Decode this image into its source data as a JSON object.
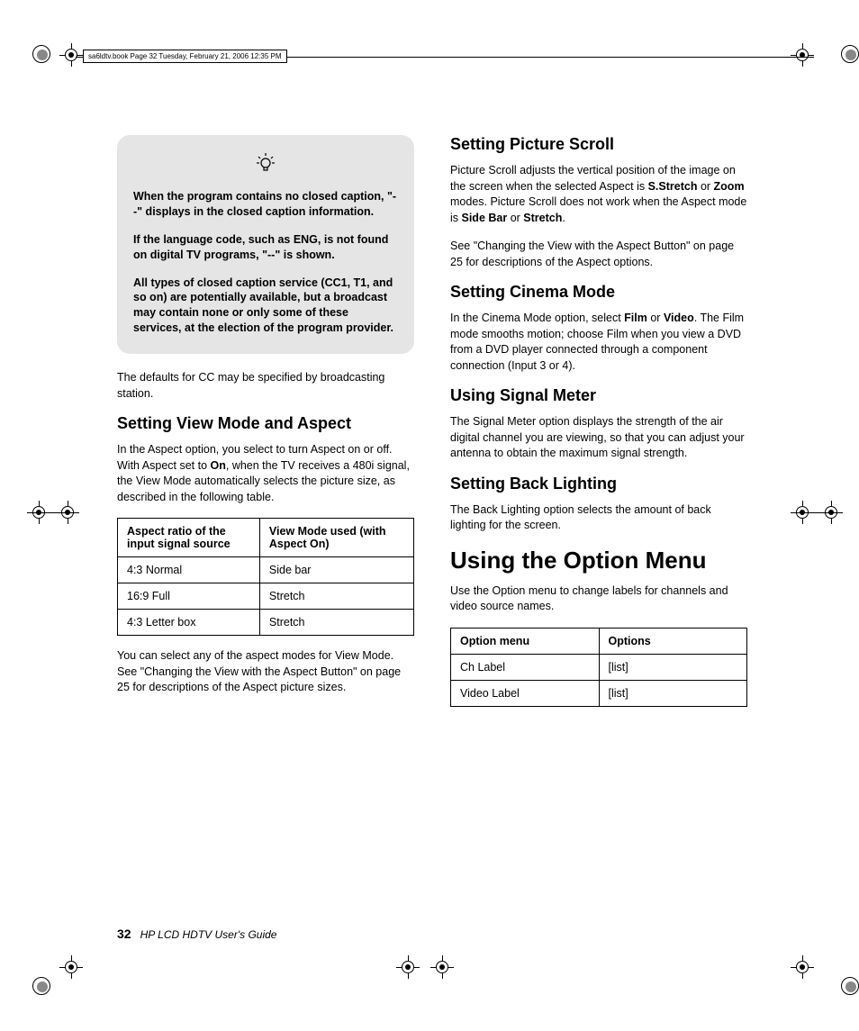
{
  "header": {
    "meta": "sa6ldtv.book  Page 32  Tuesday, February 21, 2006  12:35 PM"
  },
  "left": {
    "note1": "When the program contains no closed caption, \"--\" displays in the closed caption information.",
    "note2": "If the language code, such as ENG, is not found on digital TV programs, \"--\" is shown.",
    "note3": "All types of closed caption service (CC1, T1, and so on) are potentially available, but a broadcast may contain none or only some of these services, at the election of the program provider.",
    "p1": "The defaults for CC may be specified by broadcasting station.",
    "h_view": "Setting View Mode and Aspect",
    "p_view_a": "In the Aspect option, you select to turn Aspect on or off. With Aspect set to ",
    "p_view_b": "On",
    "p_view_c": ", when the TV receives a 480i signal, the View Mode automatically selects the picture size, as described in the following table.",
    "th1": "Aspect ratio of the input signal source",
    "th2": "View Mode used (with Aspect On)",
    "r1c1": "4:3 Normal",
    "r1c2": "Side bar",
    "r2c1": "16:9 Full",
    "r2c2": "Stretch",
    "r3c1": "4:3 Letter box",
    "r3c2": "Stretch",
    "p_after": "You can select any of the aspect modes for View Mode. See \"Changing the View with the Aspect Button\" on page 25 for descriptions of the Aspect picture sizes."
  },
  "right": {
    "h_scroll": "Setting Picture Scroll",
    "p_scroll_a": "Picture Scroll adjusts the vertical position of the image on the screen when the selected Aspect is ",
    "b_sstretch": "S.Stretch",
    "p_scroll_b": " or ",
    "b_zoom": "Zoom",
    "p_scroll_c": " modes. Picture Scroll does not work when the Aspect mode is ",
    "b_sidebar": "Side Bar",
    "p_scroll_d": " or ",
    "b_stretch": "Stretch",
    "p_scroll_e": ".",
    "p_scroll2": "See \"Changing the View with the Aspect Button\" on page 25 for descriptions of the Aspect options.",
    "h_cinema": "Setting Cinema Mode",
    "p_cinema_a": "In the Cinema Mode option, select ",
    "b_film": "Film",
    "p_cinema_b": " or ",
    "b_video": "Video",
    "p_cinema_c": ". The Film mode smooths motion; choose Film when you view a DVD from a DVD player connected through a component connection (Input 3 or 4).",
    "h_signal": "Using Signal Meter",
    "p_signal": "The Signal Meter option displays the strength of the air digital channel you are viewing, so that you can adjust your antenna to obtain the maximum signal strength.",
    "h_back": "Setting Back Lighting",
    "p_back": "The Back Lighting option selects the amount of back lighting for the screen.",
    "h_option": "Using the Option Menu",
    "p_option": "Use the Option menu to change labels for channels and video source names.",
    "th1": "Option menu",
    "th2": "Options",
    "r1c1": "Ch Label",
    "r1c2": "[list]",
    "r2c1": "Video Label",
    "r2c2": "[list]"
  },
  "footer": {
    "page": "32",
    "title": "HP LCD HDTV User's Guide"
  }
}
